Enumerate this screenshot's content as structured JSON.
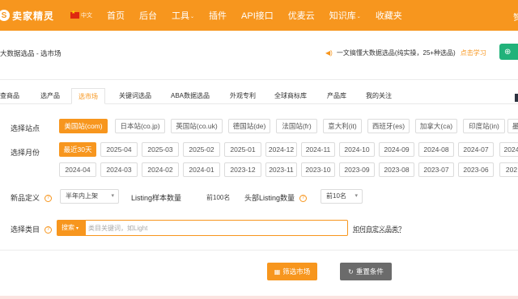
{
  "brand": {
    "logo_letter": "S",
    "name": "卖家精灵",
    "lang": "中文"
  },
  "nav": {
    "items": [
      {
        "label": "首页",
        "caret": false
      },
      {
        "label": "后台",
        "caret": false
      },
      {
        "label": "工具",
        "caret": true
      },
      {
        "label": "插件",
        "caret": false
      },
      {
        "label": "API接口",
        "caret": false
      },
      {
        "label": "优麦云",
        "caret": false
      },
      {
        "label": "知识库",
        "caret": true
      },
      {
        "label": "收藏夹",
        "caret": false
      }
    ],
    "right_text": "赞"
  },
  "breadcrumb": "大数据选品 - 选市场",
  "tip": {
    "text": "一文搞懂大数据选品(纯实操，25+种选品)",
    "link": "点击学习"
  },
  "tabs": [
    "查商品",
    "选产品",
    "选市场",
    "关键词选品",
    "ABA数据选品",
    "外观专利",
    "全球商标库",
    "产品库",
    "我的关注"
  ],
  "active_tab": "选市场",
  "site": {
    "label": "选择站点",
    "options": [
      "美国站(com)",
      "日本站(co.jp)",
      "英国站(co.uk)",
      "德国站(de)",
      "法国站(fr)",
      "意大利(it)",
      "西班牙(es)",
      "加拿大(ca)",
      "印度站(in)",
      "墨"
    ],
    "selected": "美国站(com)"
  },
  "month": {
    "label": "选择月份",
    "row1": [
      "最近30天",
      "2025-04",
      "2025-03",
      "2025-02",
      "2025-01",
      "2024-12",
      "2024-11",
      "2024-10",
      "2024-09",
      "2024-08",
      "2024-07",
      "2024"
    ],
    "row2": [
      "2024-04",
      "2024-03",
      "2024-02",
      "2024-01",
      "2023-12",
      "2023-11",
      "2023-10",
      "2023-09",
      "2023-08",
      "2023-07",
      "2023-06",
      "202"
    ],
    "selected": "最近30天"
  },
  "filters": {
    "new_label": "新品定义",
    "new_value": "半年内上架",
    "sample_label": "Listing样本数量",
    "sample_value": "前100名",
    "head_label": "头部Listing数量",
    "head_value": "前10名"
  },
  "category": {
    "label": "选择类目",
    "search_type": "搜索",
    "placeholder": "类目关键词，如Light",
    "custom_link": "如何自定义品类?"
  },
  "actions": {
    "filter": "筛选市场",
    "reset": "重置条件"
  },
  "colors": {
    "brand": "#f7961e",
    "green": "#21b27a",
    "reset": "#6b6b6b"
  }
}
